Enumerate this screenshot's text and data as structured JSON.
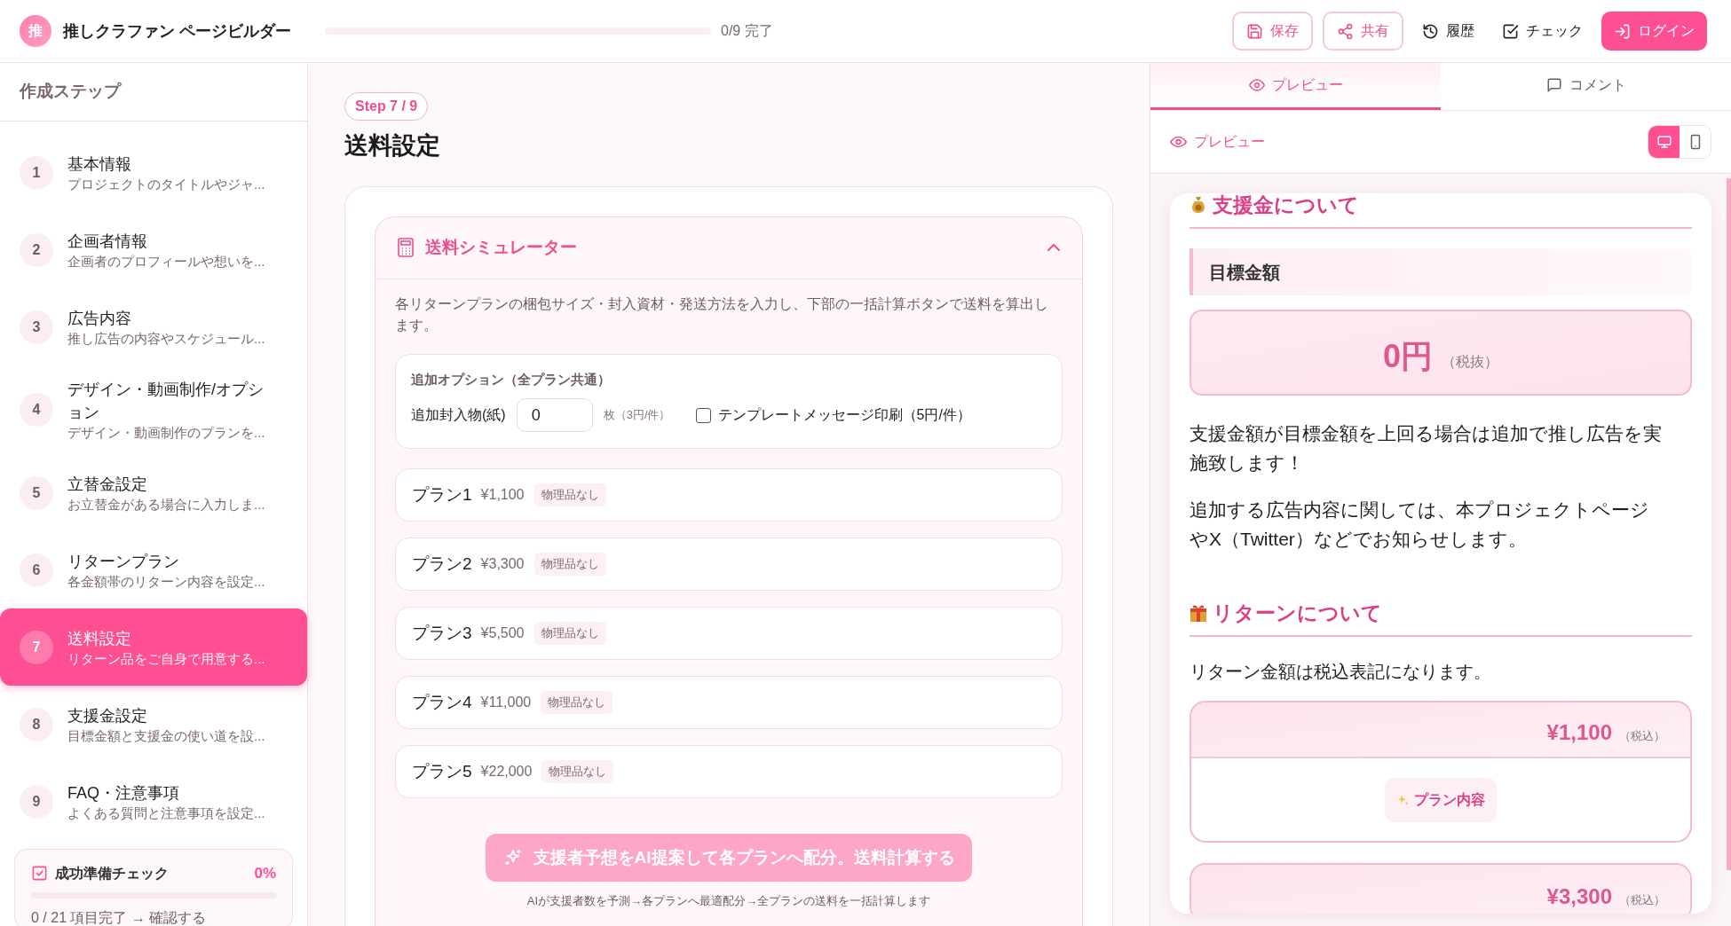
{
  "app": {
    "logo_char": "推",
    "title": "推しクラファン ページビルダー",
    "progress": {
      "level": 0,
      "label": "0/9 完了"
    }
  },
  "toolbar": [
    {
      "kind": "outline",
      "label": "保存"
    },
    {
      "kind": "outline",
      "label": "共有"
    },
    {
      "kind": "plain",
      "label": "履歴"
    },
    {
      "kind": "plain",
      "label": "チェック"
    },
    {
      "kind": "primary",
      "label": "ログイン"
    }
  ],
  "sidebar": {
    "title": "作成ステップ",
    "steps": [
      {
        "number": "1",
        "title": "基本情報",
        "description": "プロジェクトのタイトルやジャ...",
        "selected": false
      },
      {
        "number": "2",
        "title": "企画者情報",
        "description": "企画者のプロフィールや想いを...",
        "selected": false
      },
      {
        "number": "3",
        "title": "広告内容",
        "description": "推し広告の内容やスケジュール...",
        "selected": false
      },
      {
        "number": "4",
        "title": "デザイン・動画制作/オプション",
        "description": "デザイン・動画制作のプランを...",
        "selected": false
      },
      {
        "number": "5",
        "title": "立替金設定",
        "description": "お立替金がある場合に入力しま...",
        "selected": false
      },
      {
        "number": "6",
        "title": "リターンプラン",
        "description": "各金額帯のリターン内容を設定...",
        "selected": false
      },
      {
        "number": "7",
        "title": "送料設定",
        "description": "リターン品をご自身で用意する...",
        "selected": true
      },
      {
        "number": "8",
        "title": "支援金設定",
        "description": "目標金額と支援金の使い道を設...",
        "selected": false
      },
      {
        "number": "9",
        "title": "FAQ・注意事項",
        "description": "よくある質問と注意事項を設定...",
        "selected": false
      }
    ],
    "checklist": {
      "title": "成功準備チェック",
      "percent": "0%",
      "level": 0,
      "status": "0 / 21 項目完了 → 確認する"
    }
  },
  "main": {
    "step_badge": "Step 7 / 9",
    "title": "送料設定",
    "simulator": {
      "title": "送料シミュレーター",
      "expanded": true,
      "description": "各リターンプランの梱包サイズ・封入資材・発送方法を入力し、下部の一括計算ボタンで送料を算出します。",
      "options": {
        "title": "追加オプション（全プラン共通）",
        "insert_label": "追加封入物(紙)",
        "insert_value": "0",
        "insert_unit": "枚（3円/件）",
        "template_label": "テンプレートメッセージ印刷（5円/件）",
        "template_checked": false
      },
      "plans": [
        {
          "name": "プラン1",
          "price": "¥1,100",
          "tag": "物理品なし"
        },
        {
          "name": "プラン2",
          "price": "¥3,300",
          "tag": "物理品なし"
        },
        {
          "name": "プラン3",
          "price": "¥5,500",
          "tag": "物理品なし"
        },
        {
          "name": "プラン4",
          "price": "¥11,000",
          "tag": "物理品なし"
        },
        {
          "name": "プラン5",
          "price": "¥22,000",
          "tag": "物理品なし"
        }
      ],
      "ai_button": "支援者予想をAI提案して各プランへ配分。送料計算する",
      "ai_note": "AIが支援者数を予測→各プランへ最適配分→全プランの送料を一括計算します"
    }
  },
  "preview_panel": {
    "tabs": [
      {
        "label": "プレビュー",
        "selected": true
      },
      {
        "label": "コメント",
        "selected": false
      }
    ],
    "toolbar_label": "プレビュー",
    "devices": [
      {
        "selected": true
      },
      {
        "selected": false
      }
    ],
    "support": {
      "heading": "支援金について",
      "subheading": "目標金額",
      "amount": "0円",
      "amount_note": "（税抜）",
      "paragraphs": [
        "支援金額が目標金額を上回る場合は追加で推し広告を実施致します！",
        "追加する広告内容に関しては、本プロジェクトページやX（Twitter）などでお知らせします。"
      ]
    },
    "returns": {
      "heading": "リターンについて",
      "note": "リターン金額は税込表記になります。",
      "plans": [
        {
          "price": "¥1,100",
          "tax_note": "（税込）",
          "content_label": "プラン内容"
        },
        {
          "price": "¥3,300",
          "tax_note": "（税込）"
        }
      ]
    }
  }
}
